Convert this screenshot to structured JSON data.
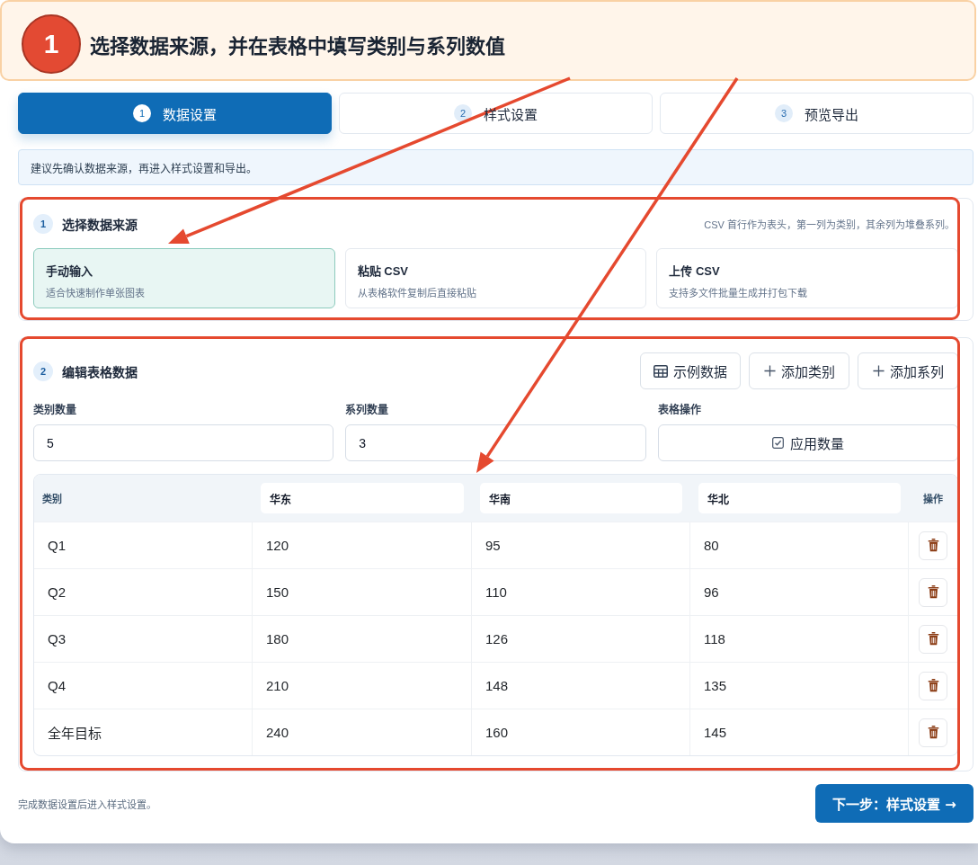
{
  "callout": {
    "number": "1",
    "text": "选择数据来源，并在表格中填写类别与系列数值"
  },
  "steps": [
    {
      "number": "1",
      "label": "数据设置",
      "selected": true
    },
    {
      "number": "2",
      "label": "样式设置",
      "selected": false
    },
    {
      "number": "3",
      "label": "预览导出",
      "selected": false
    }
  ],
  "notice": "建议先确认数据来源，再进入样式设置和导出。",
  "source_section": {
    "number": "1",
    "title": "选择数据来源",
    "hint": "CSV 首行作为表头，第一列为类别，其余列为堆叠系列。",
    "highlighted": true,
    "options": [
      {
        "title": "手动输入",
        "description": "适合快速制作单张图表",
        "selected": true
      },
      {
        "title": "粘贴 CSV",
        "description": "从表格软件复制后直接粘贴",
        "selected": false
      },
      {
        "title": "上传 CSV",
        "description": "支持多文件批量生成并打包下载",
        "selected": false
      }
    ]
  },
  "table_section": {
    "number": "2",
    "title": "编辑表格数据",
    "highlighted": true,
    "actions": [
      {
        "kind": "table",
        "label": "示例数据"
      },
      {
        "kind": "add",
        "label": "添加类别"
      },
      {
        "kind": "add",
        "label": "添加系列"
      }
    ],
    "fields": [
      {
        "label": "类别数量",
        "value": "5"
      },
      {
        "label": "系列数量",
        "value": "3"
      }
    ],
    "apply": {
      "label": "表格操作",
      "button": "应用数量"
    },
    "table": {
      "columns": [
        {
          "kind": "category",
          "label": "类别"
        },
        {
          "kind": "series",
          "label": "华东"
        },
        {
          "kind": "series",
          "label": "华南"
        },
        {
          "kind": "series",
          "label": "华北"
        },
        {
          "kind": "actions",
          "label": "操作"
        }
      ],
      "rows": [
        {
          "cells": [
            "Q1",
            "120",
            "95",
            "80"
          ]
        },
        {
          "cells": [
            "Q2",
            "150",
            "110",
            "96"
          ]
        },
        {
          "cells": [
            "Q3",
            "180",
            "126",
            "118"
          ]
        },
        {
          "cells": [
            "Q4",
            "210",
            "148",
            "135"
          ]
        },
        {
          "cells": [
            "全年目标",
            "240",
            "160",
            "145"
          ]
        }
      ]
    }
  },
  "footer": {
    "note": "完成数据设置后进入样式设置。",
    "next_button": "下一步：样式设置 →"
  }
}
